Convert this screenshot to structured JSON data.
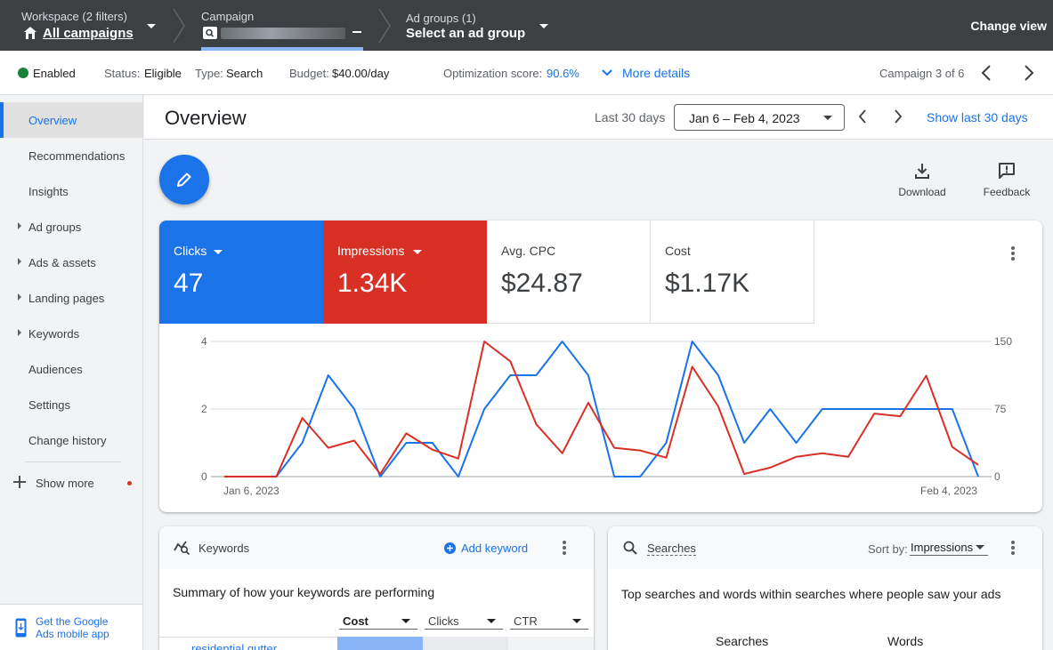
{
  "topbar": {
    "workspace_label": "Workspace (2 filters)",
    "workspace_value": "All campaigns",
    "campaign_label": "Campaign",
    "adgroups_label": "Ad groups (1)",
    "adgroups_value": "Select an ad group",
    "change_view": "Change view"
  },
  "status": {
    "enabled": "Enabled",
    "status_label": "Status:",
    "status_value": "Eligible",
    "type_label": "Type:",
    "type_value": "Search",
    "budget_label": "Budget:",
    "budget_value": "$40.00/day",
    "opt_label": "Optimization score:",
    "opt_value": "90.6%",
    "more_details": "More details",
    "campaign_pos": "Campaign 3 of 6"
  },
  "sidebar": {
    "items": [
      {
        "label": "Overview"
      },
      {
        "label": "Recommendations"
      },
      {
        "label": "Insights"
      },
      {
        "label": "Ad groups"
      },
      {
        "label": "Ads & assets"
      },
      {
        "label": "Landing pages"
      },
      {
        "label": "Keywords"
      },
      {
        "label": "Audiences"
      },
      {
        "label": "Settings"
      },
      {
        "label": "Change history"
      }
    ],
    "show_more": "Show more",
    "mobile_line1": "Get the Google",
    "mobile_line2": "Ads mobile app"
  },
  "header": {
    "title": "Overview",
    "range_label": "Last 30 days",
    "date_range": "Jan 6 – Feb 4, 2023",
    "show_last": "Show last 30 days"
  },
  "tools": {
    "download": "Download",
    "feedback": "Feedback"
  },
  "metrics": [
    {
      "name": "Clicks",
      "value": "47",
      "color": "#1a73e8"
    },
    {
      "name": "Impressions",
      "value": "1.34K",
      "color": "#d93025"
    },
    {
      "name": "Avg. CPC",
      "value": "$24.87"
    },
    {
      "name": "Cost",
      "value": "$1.17K"
    }
  ],
  "chart_data": {
    "type": "line",
    "x_start_label": "Jan 6, 2023",
    "x_end_label": "Feb 4, 2023",
    "y_left_ticks": [
      "4",
      "2",
      "0"
    ],
    "y_right_ticks": [
      "150",
      "75",
      "0"
    ],
    "ylim_left": [
      0,
      4
    ],
    "ylim_right": [
      0,
      150
    ],
    "grid": true,
    "series": [
      {
        "name": "Clicks",
        "axis": "left",
        "color": "#1a73e8",
        "values": [
          0,
          0,
          0,
          1,
          3,
          2,
          0,
          1,
          1,
          0,
          2,
          3,
          3,
          4,
          3,
          0,
          0,
          1,
          4,
          3,
          1,
          2,
          1,
          2,
          2,
          2,
          2,
          2,
          2,
          0
        ]
      },
      {
        "name": "Impressions",
        "axis": "right",
        "color": "#d93025",
        "values": [
          0,
          0,
          0,
          65,
          32,
          40,
          3,
          48,
          30,
          20,
          150,
          128,
          58,
          26,
          82,
          32,
          29,
          21,
          122,
          78,
          3,
          10,
          22,
          26,
          22,
          70,
          67,
          112,
          33,
          13
        ]
      }
    ]
  },
  "keywords_panel": {
    "title": "Keywords",
    "add": "Add keyword",
    "summary": "Summary of how your keywords are performing",
    "col1": "Cost",
    "col2": "Clicks",
    "col3": "CTR",
    "first_row": "residential gutter"
  },
  "searches_panel": {
    "title": "Searches",
    "sort_label": "Sort by:",
    "sort_value": "Impressions",
    "summary": "Top searches and words within searches where people saw your ads",
    "col1": "Searches",
    "col2": "Words"
  }
}
